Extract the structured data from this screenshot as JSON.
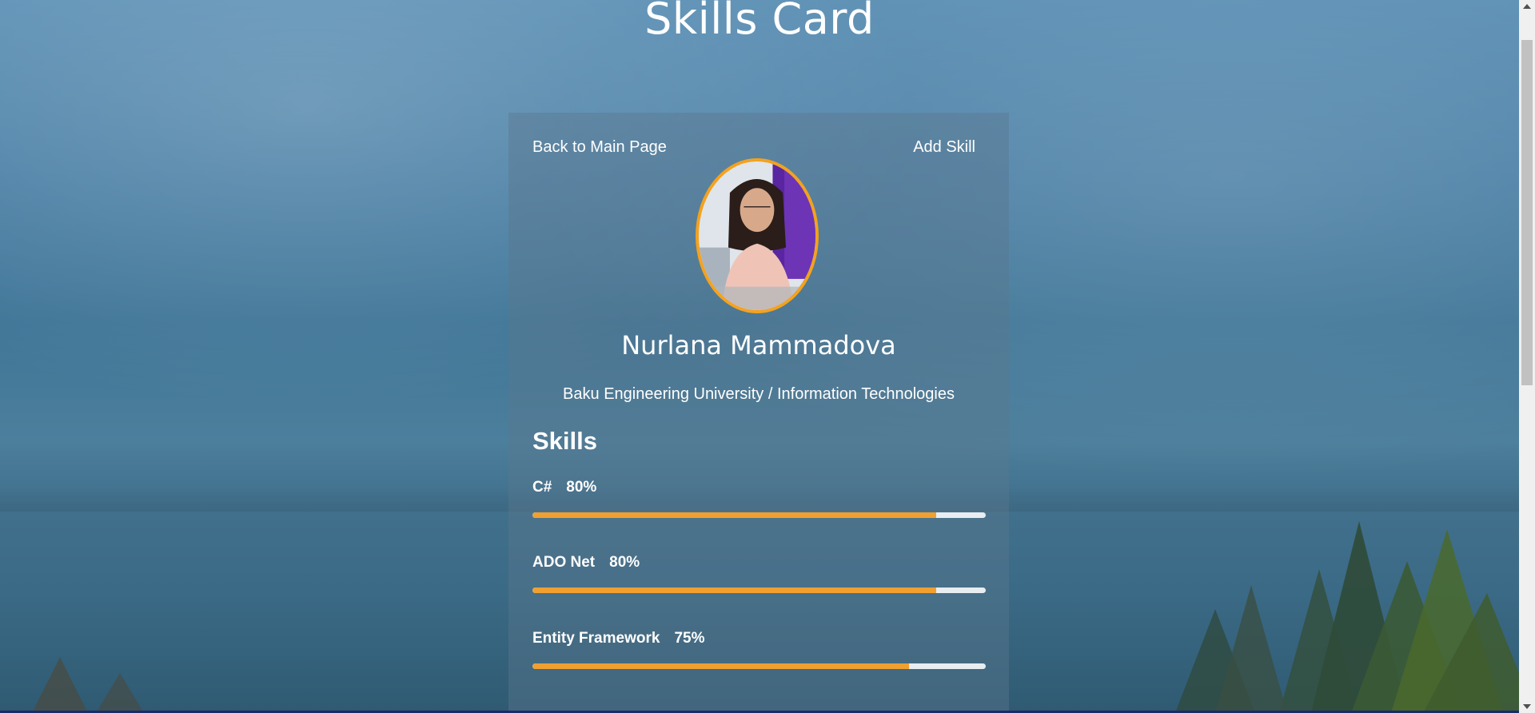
{
  "page": {
    "title": "Skills Card"
  },
  "card": {
    "nav": {
      "back_label": "Back to Main Page",
      "add_label": "Add Skill"
    },
    "name": "Nurlana Mammadova",
    "affiliation": "Baku Engineering University / Information Technologies",
    "skills_heading": "Skills",
    "skills": [
      {
        "name": "C#",
        "percent_label": "80%",
        "level": 0.89
      },
      {
        "name": "ADO Net",
        "percent_label": "80%",
        "level": 0.89
      },
      {
        "name": "Entity Framework",
        "percent_label": "75%",
        "level": 0.83
      }
    ]
  },
  "colors": {
    "accent": "#f0a030",
    "avatar_border": "#f4a21e",
    "track": "#e8edf1",
    "text": "#ffffff"
  }
}
